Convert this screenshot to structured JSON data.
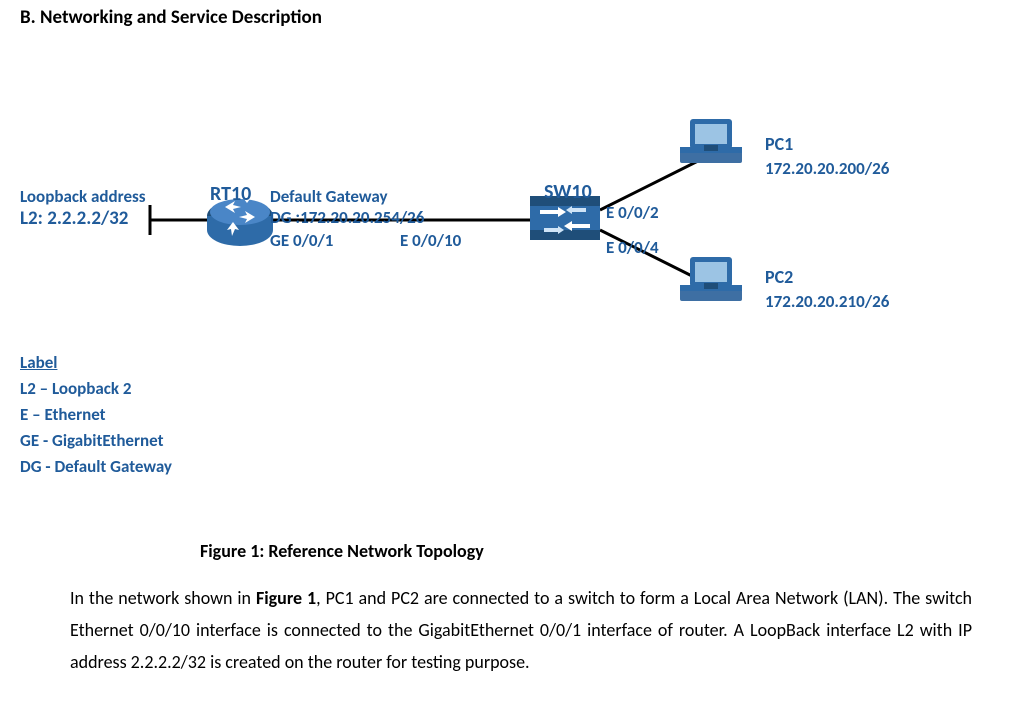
{
  "section_title": "B. Networking and Service Description",
  "router": {
    "name": "RT10",
    "loopback_label": "Loopback address",
    "loopback_value": "L2: 2.2.2.2/32",
    "dg_label": "Default Gateway",
    "dg_value": "DG :172.20.20.254/26",
    "ge_port": "GE 0/0/1"
  },
  "switch": {
    "name": "SW10",
    "uplink_port": "E 0/0/10",
    "port_pc1": "E 0/0/2",
    "port_pc2": "E 0/0/4"
  },
  "pc1": {
    "name": "PC1",
    "ip": "172.20.20.200/26"
  },
  "pc2": {
    "name": "PC2",
    "ip": "172.20.20.210/26"
  },
  "legend": {
    "heading": "Label",
    "lines": [
      "L2 – Loopback 2",
      "E – Ethernet",
      "GE - GigabitEthernet",
      "DG - Default Gateway"
    ]
  },
  "figure": {
    "caption_prefix": "Figure 1",
    "caption_rest": ": Reference Network Topology"
  },
  "paragraph": {
    "p1": "In the network shown in ",
    "p1b": "Figure 1",
    "p2": ", PC1 and PC2 are connected to a switch to form a Local Area Network (LAN).  The switch Ethernet 0/0/10 interface is connected to the GigabitEthernet 0/0/1 interface of router. A LoopBack interface L2 with IP address 2.2.2.2/32 is created on the router for testing purpose."
  }
}
